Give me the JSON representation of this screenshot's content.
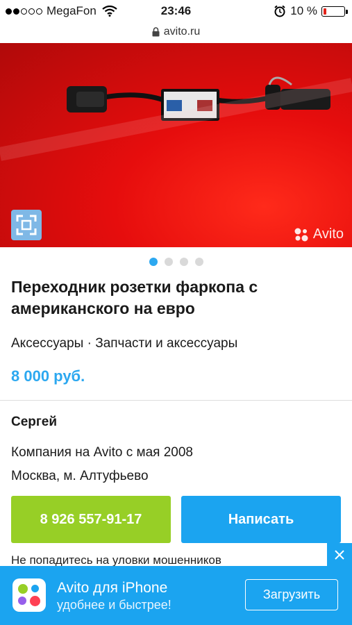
{
  "status": {
    "carrier": "MegaFon",
    "time": "23:46",
    "battery": "10 %"
  },
  "browser": {
    "url": "avito.ru"
  },
  "gallery": {
    "watermark": "Avito",
    "page_count": 4,
    "active_index": 0
  },
  "listing": {
    "title": "Переходник розетки фаркопа с американского на евро",
    "category": "Аксессуары · Запчасти и аксессуары",
    "price": "8 000 руб."
  },
  "seller": {
    "name": "Сергей",
    "since": "Компания на Avito с мая 2008",
    "location": "Москва, м. Алтуфьево"
  },
  "actions": {
    "phone": "8 926 557-91-17",
    "write": "Написать"
  },
  "warning": "Не попадитесь на уловки мошенников",
  "app_banner": {
    "title": "Avito для iPhone",
    "subtitle": "удобнее и быстрее!",
    "button": "Загрузить"
  },
  "colors": {
    "accent": "#1ba4f0",
    "phone_button": "#97cf26",
    "price": "#2ca8f0"
  }
}
